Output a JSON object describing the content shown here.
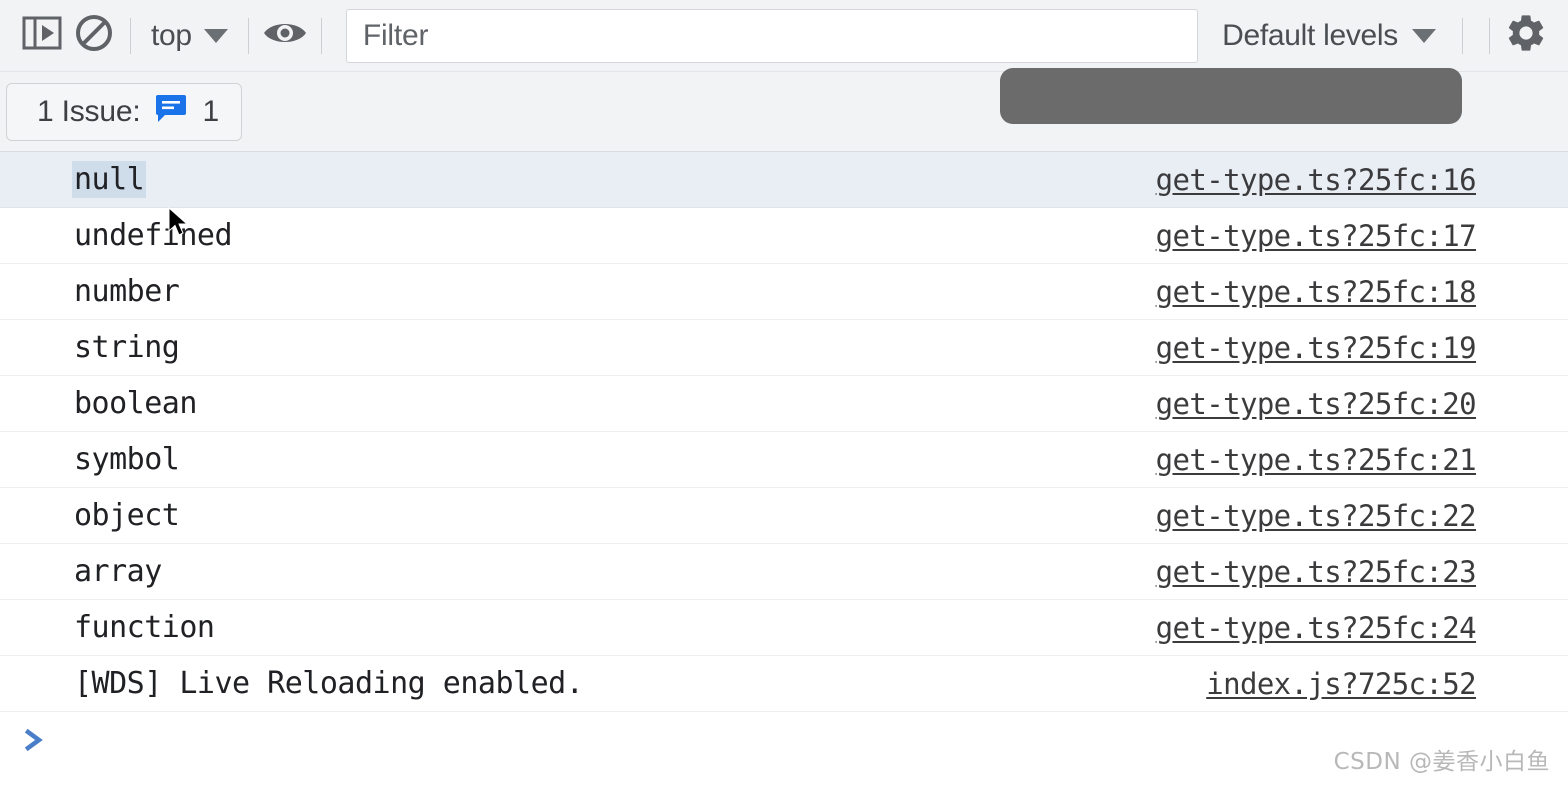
{
  "toolbar": {
    "sidebar_toggle_title": "Show console sidebar",
    "clear_console_title": "Clear console",
    "context_selector": "top",
    "eye_title": "Create live expression",
    "filter": {
      "value": "",
      "placeholder": "Filter"
    },
    "log_levels": "Default levels",
    "settings_title": "Console settings"
  },
  "issues": {
    "label": "1 Issue:",
    "count": "1",
    "icon": "issue-message-icon",
    "icon_color": "#1a73e8"
  },
  "redaction": {
    "color": "#6b6b6b"
  },
  "console": {
    "rows": [
      {
        "message": "null",
        "source": "get-type.ts?25fc:16",
        "selected": true
      },
      {
        "message": "undefined",
        "source": "get-type.ts?25fc:17",
        "selected": false
      },
      {
        "message": "number",
        "source": "get-type.ts?25fc:18",
        "selected": false
      },
      {
        "message": "string",
        "source": "get-type.ts?25fc:19",
        "selected": false
      },
      {
        "message": "boolean",
        "source": "get-type.ts?25fc:20",
        "selected": false
      },
      {
        "message": "symbol",
        "source": "get-type.ts?25fc:21",
        "selected": false
      },
      {
        "message": "object",
        "source": "get-type.ts?25fc:22",
        "selected": false
      },
      {
        "message": "array",
        "source": "get-type.ts?25fc:23",
        "selected": false
      },
      {
        "message": "function",
        "source": "get-type.ts?25fc:24",
        "selected": false
      },
      {
        "message": "[WDS] Live Reloading enabled.",
        "source": "index.js?725c:52",
        "selected": false
      }
    ]
  },
  "prompt": {
    "chevron": "›"
  },
  "watermark": {
    "text": "CSDN @姜香小白鱼"
  },
  "colors": {
    "toolbar_bg": "#f1f3f4",
    "selected_row_bg": "#e9eef5",
    "selection_highlight": "#cfdcea",
    "prompt_blue": "#4a7ec9"
  }
}
